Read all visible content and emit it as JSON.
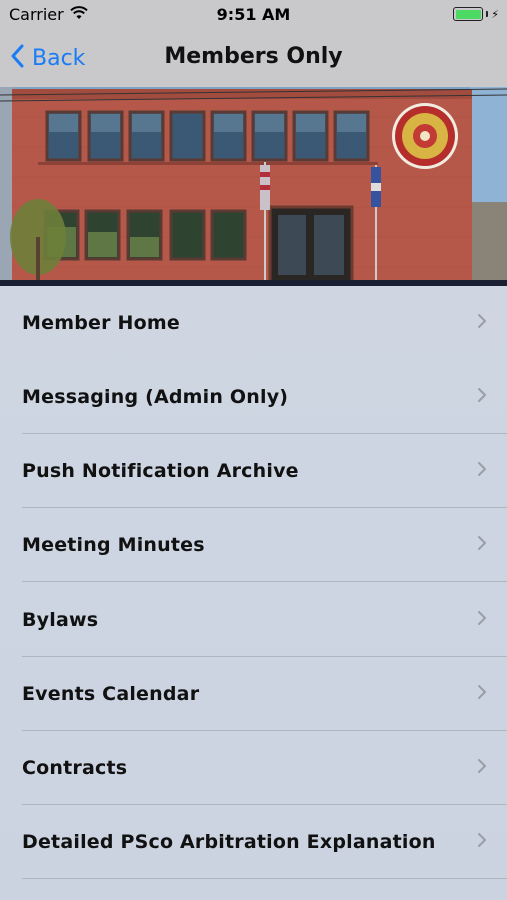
{
  "status_bar": {
    "carrier": "Carrier",
    "time": "9:51 AM",
    "icons": [
      "wifi-icon",
      "battery-icon",
      "charging-bolt-icon"
    ],
    "battery_color": "#4cd964"
  },
  "nav": {
    "back_label": "Back",
    "title": "Members Only",
    "accent": "#1a7cf4"
  },
  "hero": {
    "description_icon": "building-photo"
  },
  "menu": {
    "items": [
      {
        "label": "Member Home"
      },
      {
        "label": "Messaging (Admin Only)"
      },
      {
        "label": "Push Notification Archive"
      },
      {
        "label": "Meeting Minutes"
      },
      {
        "label": "Bylaws"
      },
      {
        "label": "Events Calendar"
      },
      {
        "label": "Contracts"
      },
      {
        "label": "Detailed PSco Arbitration Explanation"
      }
    ]
  }
}
